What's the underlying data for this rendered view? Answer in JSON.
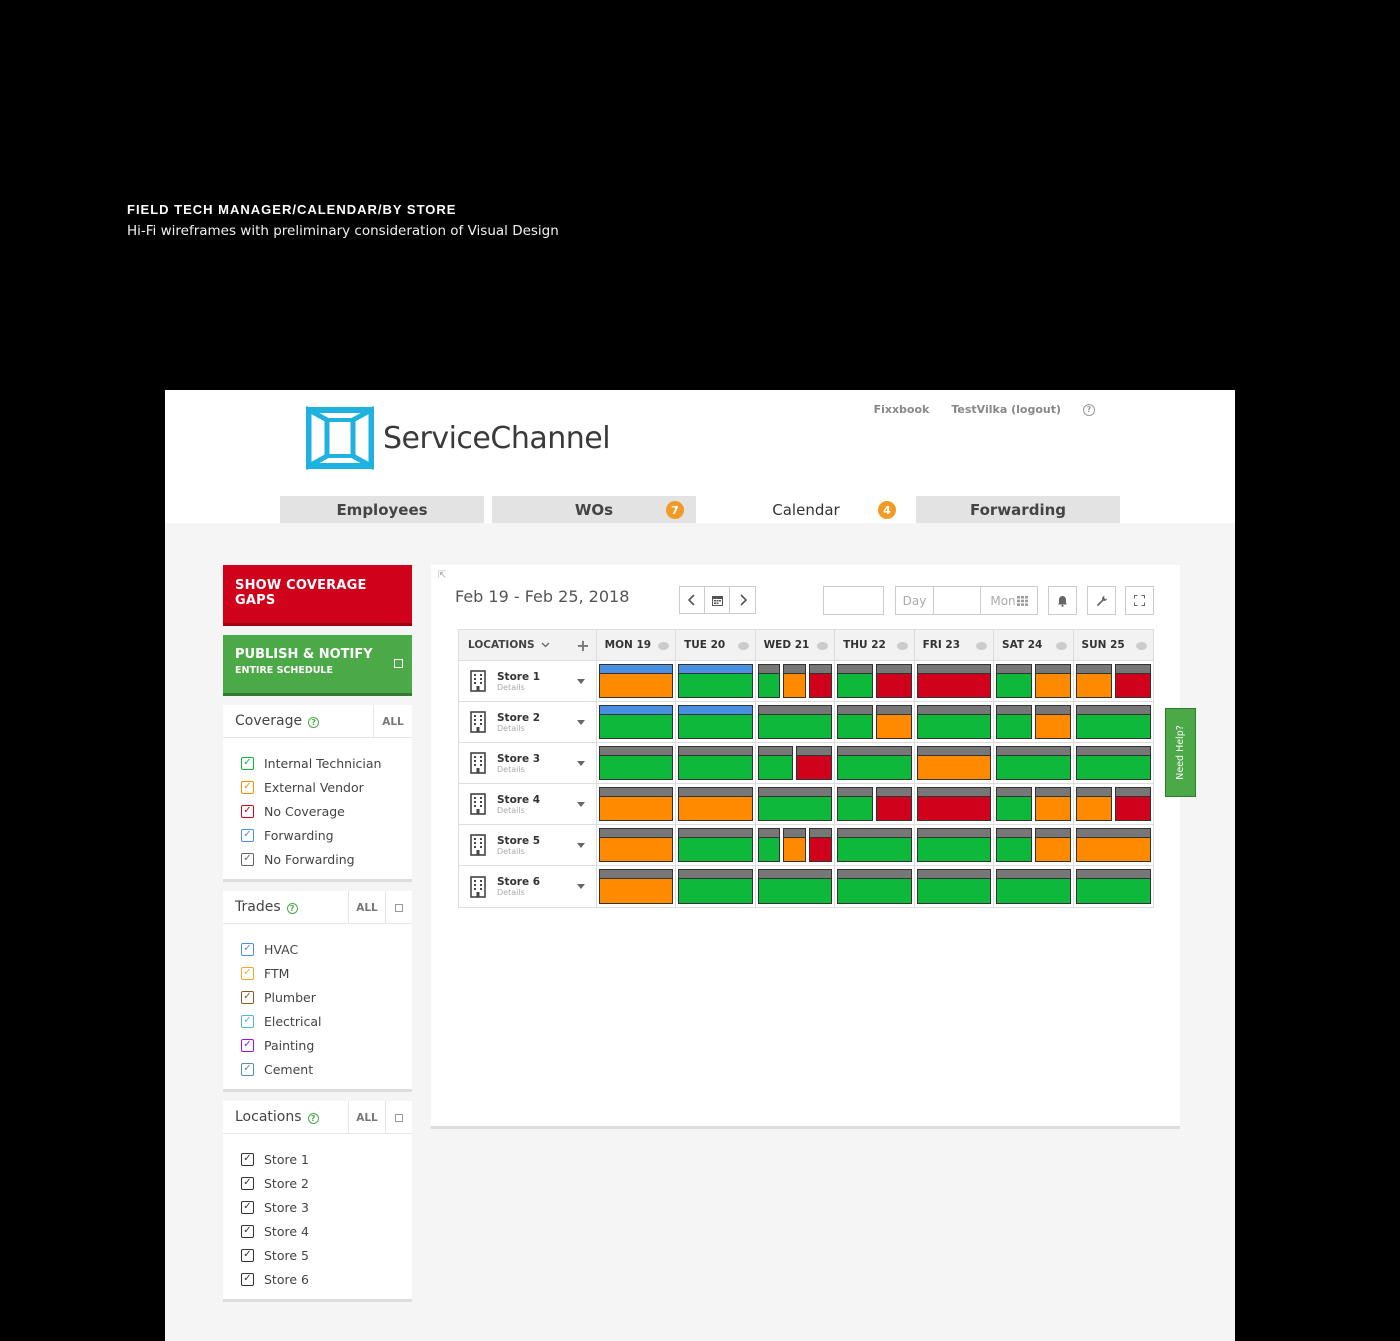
{
  "caption": {
    "title": "FIELD TECH MANAGER/CALENDAR/BY STORE",
    "subtitle": "Hi-Fi wireframes with preliminary consideration of Visual Design"
  },
  "brand": {
    "name": "ServiceChannel",
    "accent": "#1fb2e0"
  },
  "toplinks": {
    "link1": "Fixxbook",
    "link2": "TestVilka (logout)",
    "help": "?"
  },
  "tabs": [
    {
      "label": "Employees",
      "badge": ""
    },
    {
      "label": "WOs",
      "badge": "7"
    },
    {
      "label": "Calendar",
      "badge": "4"
    },
    {
      "label": "Forwarding",
      "badge": ""
    }
  ],
  "sidebar": {
    "gaps_button": "SHOW COVERAGE GAPS",
    "publish_line1": "PUBLISH & NOTIFY",
    "publish_line2": "ENTIRE SCHEDULE",
    "coverage": {
      "title": "Coverage",
      "all": "ALL",
      "items": [
        {
          "label": "Internal Technician",
          "color": "#0db83b"
        },
        {
          "label": "External Vendor",
          "color": "#ff8a00"
        },
        {
          "label": "No Coverage",
          "color": "#d0021b"
        },
        {
          "label": "Forwarding",
          "color": "#4a90e2"
        },
        {
          "label": "No Forwarding",
          "color": "#666666"
        }
      ]
    },
    "trades": {
      "title": "Trades",
      "all": "ALL",
      "items": [
        {
          "label": "HVAC",
          "color": "#4a90e2"
        },
        {
          "label": "FTM",
          "color": "#f5a623"
        },
        {
          "label": "Plumber",
          "color": "#8b572a"
        },
        {
          "label": "Electrical",
          "color": "#50b5d6"
        },
        {
          "label": "Painting",
          "color": "#9013fe"
        },
        {
          "label": "Cement",
          "color": "#5a8fa8"
        }
      ]
    },
    "locations": {
      "title": "Locations",
      "all": "ALL",
      "items": [
        {
          "label": "Store 1"
        },
        {
          "label": "Store 2"
        },
        {
          "label": "Store 3"
        },
        {
          "label": "Store 4"
        },
        {
          "label": "Store 5"
        },
        {
          "label": "Store 6"
        }
      ]
    }
  },
  "calendar": {
    "date_range": "Feb 19 - Feb 25, 2018",
    "view_day": "Day",
    "view_month": "Mon",
    "locations_header": "LOCATIONS",
    "days": [
      "MON 19",
      "TUE 20",
      "WED 21",
      "THU 22",
      "FRI 23",
      "SAT 24",
      "SUN 25"
    ],
    "detail_label": "Details",
    "stores": [
      {
        "name": "Store 1",
        "days": [
          [
            [
              "blue",
              "orange"
            ]
          ],
          [
            [
              "blue",
              "green"
            ]
          ],
          [
            [
              "grey",
              "green"
            ],
            [
              "grey",
              "orange"
            ],
            [
              "grey",
              "red"
            ]
          ],
          [
            [
              "grey",
              "green"
            ],
            [
              "grey",
              "red"
            ]
          ],
          [
            [
              "grey",
              "red"
            ]
          ],
          [
            [
              "grey",
              "green"
            ],
            [
              "grey",
              "orange"
            ]
          ],
          [
            [
              "grey",
              "orange"
            ],
            [
              "grey",
              "red"
            ]
          ]
        ]
      },
      {
        "name": "Store 2",
        "days": [
          [
            [
              "blue",
              "green"
            ]
          ],
          [
            [
              "blue",
              "green"
            ]
          ],
          [
            [
              "grey",
              "green"
            ]
          ],
          [
            [
              "grey",
              "green"
            ],
            [
              "grey",
              "orange"
            ]
          ],
          [
            [
              "grey",
              "green"
            ]
          ],
          [
            [
              "grey",
              "green"
            ],
            [
              "grey",
              "orange"
            ]
          ],
          [
            [
              "grey",
              "green"
            ]
          ]
        ]
      },
      {
        "name": "Store 3",
        "days": [
          [
            [
              "grey",
              "green"
            ]
          ],
          [
            [
              "grey",
              "green"
            ]
          ],
          [
            [
              "grey",
              "green"
            ],
            [
              "grey",
              "red"
            ]
          ],
          [
            [
              "grey",
              "green"
            ]
          ],
          [
            [
              "grey",
              "orange"
            ]
          ],
          [
            [
              "grey",
              "green"
            ]
          ],
          [
            [
              "grey",
              "green"
            ]
          ]
        ]
      },
      {
        "name": "Store 4",
        "days": [
          [
            [
              "grey",
              "orange"
            ]
          ],
          [
            [
              "grey",
              "orange"
            ]
          ],
          [
            [
              "grey",
              "green"
            ]
          ],
          [
            [
              "grey",
              "green"
            ],
            [
              "grey",
              "red"
            ]
          ],
          [
            [
              "grey",
              "red"
            ]
          ],
          [
            [
              "grey",
              "green"
            ],
            [
              "grey",
              "orange"
            ]
          ],
          [
            [
              "grey",
              "orange"
            ],
            [
              "grey",
              "red"
            ]
          ]
        ]
      },
      {
        "name": "Store 5",
        "days": [
          [
            [
              "grey",
              "orange"
            ]
          ],
          [
            [
              "grey",
              "green"
            ]
          ],
          [
            [
              "grey",
              "green"
            ],
            [
              "grey",
              "orange"
            ],
            [
              "grey",
              "red"
            ]
          ],
          [
            [
              "grey",
              "green"
            ]
          ],
          [
            [
              "grey",
              "green"
            ]
          ],
          [
            [
              "grey",
              "green"
            ],
            [
              "grey",
              "orange"
            ]
          ],
          [
            [
              "grey",
              "orange"
            ]
          ]
        ]
      },
      {
        "name": "Store 6",
        "days": [
          [
            [
              "grey",
              "orange"
            ]
          ],
          [
            [
              "grey",
              "green"
            ]
          ],
          [
            [
              "grey",
              "green"
            ]
          ],
          [
            [
              "grey",
              "green"
            ]
          ],
          [
            [
              "grey",
              "green"
            ]
          ],
          [
            [
              "grey",
              "green"
            ]
          ],
          [
            [
              "grey",
              "green"
            ]
          ]
        ]
      }
    ]
  },
  "need_help": "Need Help?"
}
